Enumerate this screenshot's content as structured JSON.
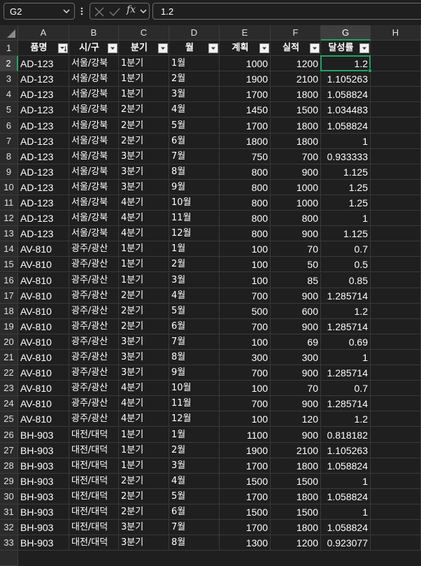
{
  "formula_bar": {
    "name_box": "G2",
    "formula_value": "1.2"
  },
  "columns": [
    "A",
    "B",
    "C",
    "D",
    "E",
    "F",
    "G",
    "H"
  ],
  "selected_column": "G",
  "selected_row": "2",
  "headers": [
    "품명",
    "시/구",
    "분기",
    "월",
    "계획",
    "실적",
    "달성률"
  ],
  "rows": [
    {
      "num": "2",
      "a": "AD-123",
      "b": "서울/강북",
      "c": "1분기",
      "d": "1월",
      "e": "1000",
      "f": "1200",
      "g": "1.2"
    },
    {
      "num": "3",
      "a": "AD-123",
      "b": "서울/강북",
      "c": "1분기",
      "d": "2월",
      "e": "1900",
      "f": "2100",
      "g": "1.105263"
    },
    {
      "num": "4",
      "a": "AD-123",
      "b": "서울/강북",
      "c": "1분기",
      "d": "3월",
      "e": "1700",
      "f": "1800",
      "g": "1.058824"
    },
    {
      "num": "5",
      "a": "AD-123",
      "b": "서울/강북",
      "c": "2분기",
      "d": "4월",
      "e": "1450",
      "f": "1500",
      "g": "1.034483"
    },
    {
      "num": "6",
      "a": "AD-123",
      "b": "서울/강북",
      "c": "2분기",
      "d": "5월",
      "e": "1700",
      "f": "1800",
      "g": "1.058824"
    },
    {
      "num": "7",
      "a": "AD-123",
      "b": "서울/강북",
      "c": "2분기",
      "d": "6월",
      "e": "1800",
      "f": "1800",
      "g": "1"
    },
    {
      "num": "8",
      "a": "AD-123",
      "b": "서울/강북",
      "c": "3분기",
      "d": "7월",
      "e": "750",
      "f": "700",
      "g": "0.933333"
    },
    {
      "num": "9",
      "a": "AD-123",
      "b": "서울/강북",
      "c": "3분기",
      "d": "8월",
      "e": "800",
      "f": "900",
      "g": "1.125"
    },
    {
      "num": "10",
      "a": "AD-123",
      "b": "서울/강북",
      "c": "3분기",
      "d": "9월",
      "e": "800",
      "f": "1000",
      "g": "1.25"
    },
    {
      "num": "11",
      "a": "AD-123",
      "b": "서울/강북",
      "c": "4분기",
      "d": "10월",
      "e": "800",
      "f": "1000",
      "g": "1.25"
    },
    {
      "num": "12",
      "a": "AD-123",
      "b": "서울/강북",
      "c": "4분기",
      "d": "11월",
      "e": "800",
      "f": "800",
      "g": "1"
    },
    {
      "num": "13",
      "a": "AD-123",
      "b": "서울/강북",
      "c": "4분기",
      "d": "12월",
      "e": "800",
      "f": "900",
      "g": "1.125"
    },
    {
      "num": "14",
      "a": "AV-810",
      "b": "광주/광산",
      "c": "1분기",
      "d": "1월",
      "e": "100",
      "f": "70",
      "g": "0.7"
    },
    {
      "num": "15",
      "a": "AV-810",
      "b": "광주/광산",
      "c": "1분기",
      "d": "2월",
      "e": "100",
      "f": "50",
      "g": "0.5"
    },
    {
      "num": "16",
      "a": "AV-810",
      "b": "광주/광산",
      "c": "1분기",
      "d": "3월",
      "e": "100",
      "f": "85",
      "g": "0.85"
    },
    {
      "num": "17",
      "a": "AV-810",
      "b": "광주/광산",
      "c": "2분기",
      "d": "4월",
      "e": "700",
      "f": "900",
      "g": "1.285714"
    },
    {
      "num": "18",
      "a": "AV-810",
      "b": "광주/광산",
      "c": "2분기",
      "d": "5월",
      "e": "500",
      "f": "600",
      "g": "1.2"
    },
    {
      "num": "19",
      "a": "AV-810",
      "b": "광주/광산",
      "c": "2분기",
      "d": "6월",
      "e": "700",
      "f": "900",
      "g": "1.285714"
    },
    {
      "num": "20",
      "a": "AV-810",
      "b": "광주/광산",
      "c": "3분기",
      "d": "7월",
      "e": "100",
      "f": "69",
      "g": "0.69"
    },
    {
      "num": "21",
      "a": "AV-810",
      "b": "광주/광산",
      "c": "3분기",
      "d": "8월",
      "e": "300",
      "f": "300",
      "g": "1"
    },
    {
      "num": "22",
      "a": "AV-810",
      "b": "광주/광산",
      "c": "3분기",
      "d": "9월",
      "e": "700",
      "f": "900",
      "g": "1.285714"
    },
    {
      "num": "23",
      "a": "AV-810",
      "b": "광주/광산",
      "c": "4분기",
      "d": "10월",
      "e": "100",
      "f": "70",
      "g": "0.7"
    },
    {
      "num": "24",
      "a": "AV-810",
      "b": "광주/광산",
      "c": "4분기",
      "d": "11월",
      "e": "700",
      "f": "900",
      "g": "1.285714"
    },
    {
      "num": "25",
      "a": "AV-810",
      "b": "광주/광산",
      "c": "4분기",
      "d": "12월",
      "e": "100",
      "f": "120",
      "g": "1.2"
    },
    {
      "num": "26",
      "a": "BH-903",
      "b": "대전/대덕",
      "c": "1분기",
      "d": "1월",
      "e": "1100",
      "f": "900",
      "g": "0.818182"
    },
    {
      "num": "27",
      "a": "BH-903",
      "b": "대전/대덕",
      "c": "1분기",
      "d": "2월",
      "e": "1900",
      "f": "2100",
      "g": "1.105263"
    },
    {
      "num": "28",
      "a": "BH-903",
      "b": "대전/대덕",
      "c": "1분기",
      "d": "3월",
      "e": "1700",
      "f": "1800",
      "g": "1.058824"
    },
    {
      "num": "29",
      "a": "BH-903",
      "b": "대전/대덕",
      "c": "2분기",
      "d": "4월",
      "e": "1500",
      "f": "1500",
      "g": "1"
    },
    {
      "num": "30",
      "a": "BH-903",
      "b": "대전/대덕",
      "c": "2분기",
      "d": "5월",
      "e": "1700",
      "f": "1800",
      "g": "1.058824"
    },
    {
      "num": "31",
      "a": "BH-903",
      "b": "대전/대덕",
      "c": "2분기",
      "d": "6월",
      "e": "1500",
      "f": "1500",
      "g": "1"
    },
    {
      "num": "32",
      "a": "BH-903",
      "b": "대전/대덕",
      "c": "3분기",
      "d": "7월",
      "e": "1700",
      "f": "1800",
      "g": "1.058824"
    },
    {
      "num": "33",
      "a": "BH-903",
      "b": "대전/대덕",
      "c": "3분기",
      "d": "8월",
      "e": "1300",
      "f": "1200",
      "g": "0.923077"
    }
  ],
  "colors": {
    "accent": "#21a366",
    "background": "#1f1f1f",
    "header_bg": "#2b2b2b"
  },
  "icons": [
    "chevron-down-icon",
    "more-vertical-icon",
    "cancel-icon",
    "enter-icon",
    "function-icon",
    "filter-dropdown-icon",
    "sort-ascending-filter-icon"
  ]
}
